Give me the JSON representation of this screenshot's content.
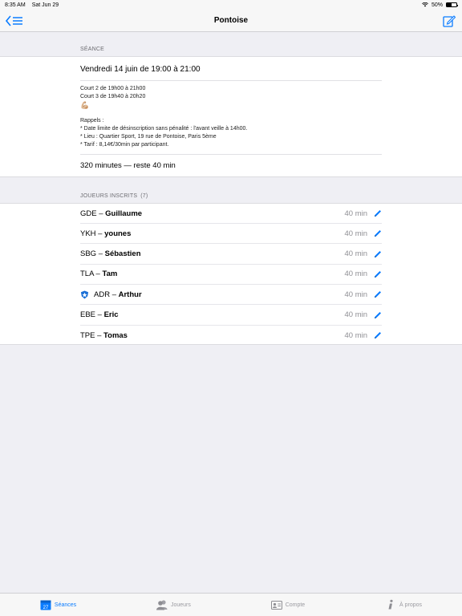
{
  "status": {
    "time": "8:35 AM",
    "date": "Sat Jun 29",
    "battery": "50%",
    "battery_level": 0.5
  },
  "nav": {
    "title": "Pontoise"
  },
  "seance": {
    "header": "SÉANCE",
    "date": "Vendredi 14 juin de 19:00 à 21:00",
    "lines": [
      "Court 2 de 19h00 à 21h00",
      "Court 3 de 19h40 à 20h20"
    ],
    "emoji": "💪🏼",
    "reminders_title": "Rappels :",
    "reminders": [
      "* Date limite de désinscription sans pénalité : l'avant veille à 14h00.",
      "* Lieu : Quartier Sport, 19 rue de Pontoise, Paris 5ème",
      "* Tarif : 8,14€/30min par participant."
    ],
    "summary": "320 minutes — reste 40 min"
  },
  "players": {
    "header": "JOUEURS INSCRITS",
    "count": "(7)",
    "items": [
      {
        "code": "GDE – ",
        "name": "Guillaume",
        "minutes": "40 min",
        "badge": false
      },
      {
        "code": "YKH – ",
        "name": "younes",
        "minutes": "40 min",
        "badge": false
      },
      {
        "code": "SBG – ",
        "name": "Sébastien",
        "minutes": "40 min",
        "badge": false
      },
      {
        "code": "TLA – ",
        "name": "Tam",
        "minutes": "40 min",
        "badge": false
      },
      {
        "code": "ADR – ",
        "name": "Arthur",
        "minutes": "40 min",
        "badge": true
      },
      {
        "code": "EBE – ",
        "name": "Eric",
        "minutes": "40 min",
        "badge": false
      },
      {
        "code": "TPE – ",
        "name": "Tomas",
        "minutes": "40 min",
        "badge": false
      }
    ]
  },
  "tabs": [
    {
      "label": "Séances",
      "icon": "calendar-icon",
      "active": true,
      "day": "27"
    },
    {
      "label": "Joueurs",
      "icon": "people-icon",
      "active": false
    },
    {
      "label": "Compte",
      "icon": "id-card-icon",
      "active": false
    },
    {
      "label": "À propos",
      "icon": "info-icon",
      "active": false
    }
  ],
  "colors": {
    "accent": "#0a7cff",
    "background": "#efeff4",
    "secondary_text": "#8e8e93"
  }
}
